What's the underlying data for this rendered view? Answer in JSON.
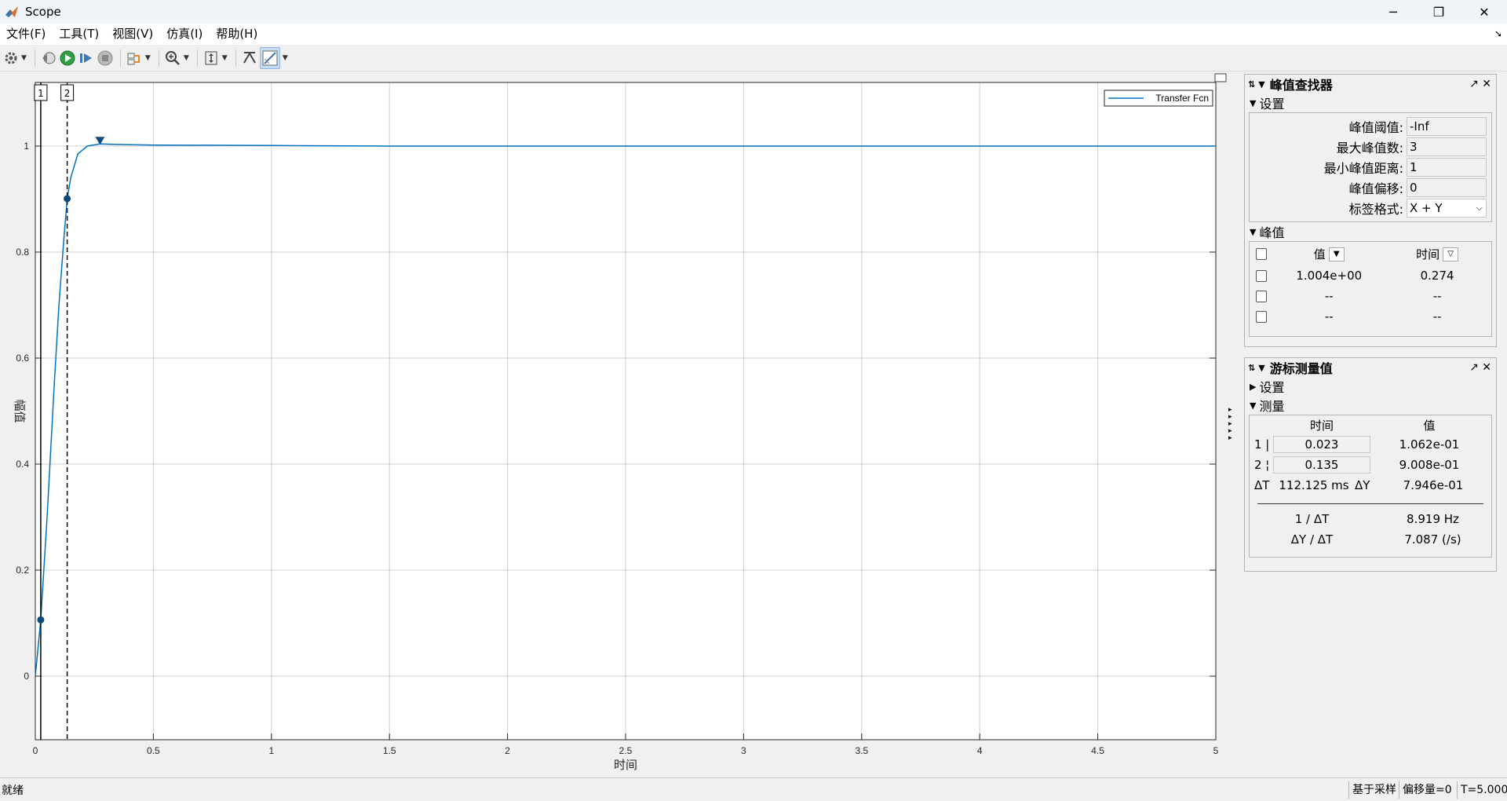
{
  "window": {
    "title": "Scope",
    "min_icon": "minimize-icon",
    "max_icon": "restore-icon",
    "close_icon": "close-icon"
  },
  "menu": {
    "items": [
      "文件(F)",
      "工具(T)",
      "视图(V)",
      "仿真(I)",
      "帮助(H)"
    ]
  },
  "toolbar": {
    "icons": [
      "settings-icon",
      "step-back-icon",
      "run-icon",
      "step-forward-icon",
      "stop-icon",
      "highlight-icon",
      "zoom-icon",
      "autoscale-icon",
      "restore-view-icon",
      "measure-icon"
    ]
  },
  "plot": {
    "legend": "Transfer Fcn",
    "ylabel": "幅值",
    "xlabel": "时间",
    "cursor_labels": [
      "1",
      "2"
    ],
    "line_color": "#0072bd"
  },
  "chart_data": {
    "type": "line",
    "series": [
      {
        "name": "Transfer Fcn",
        "x": [
          0,
          0.023,
          0.05,
          0.08,
          0.1,
          0.12,
          0.135,
          0.15,
          0.18,
          0.22,
          0.274,
          0.35,
          0.5,
          1,
          1.5,
          2,
          2.5,
          3,
          3.5,
          4,
          4.5,
          5
        ],
        "y": [
          0,
          0.1062,
          0.3,
          0.55,
          0.7,
          0.82,
          0.9008,
          0.94,
          0.985,
          1.0,
          1.004,
          1.003,
          1.002,
          1.001,
          1.0,
          1.0,
          1.0,
          1.0,
          1.0,
          1.0,
          1.0,
          1.0
        ]
      }
    ],
    "xlim": [
      0,
      5
    ],
    "ylim": [
      -0.12,
      1.12
    ],
    "xticks": [
      "0",
      "0.5",
      "1",
      "1.5",
      "2",
      "2.5",
      "3",
      "3.5",
      "4",
      "4.5",
      "5"
    ],
    "yticks": [
      "0",
      "0.2",
      "0.4",
      "0.6",
      "0.8",
      "1"
    ],
    "grid": true,
    "legend_position": "top-right",
    "cursors_x": [
      0.023,
      0.135
    ],
    "peak": {
      "x": 0.274,
      "y": 1.004
    }
  },
  "peak_finder": {
    "title": "峰值查找器",
    "settings_label": "设置",
    "fields": [
      {
        "label": "峰值阈值:",
        "value": "-Inf"
      },
      {
        "label": "最大峰值数:",
        "value": "3"
      },
      {
        "label": "最小峰值距离:",
        "value": "1"
      },
      {
        "label": "峰值偏移:",
        "value": "0"
      },
      {
        "label": "标签格式:",
        "value": "X + Y"
      }
    ],
    "peaks_label": "峰值",
    "col_value": "值",
    "col_time": "时间",
    "rows": [
      {
        "value": "1.004e+00",
        "time": "0.274"
      },
      {
        "value": "--",
        "time": "--"
      },
      {
        "value": "--",
        "time": "--"
      }
    ]
  },
  "cursor_meas": {
    "title": "游标测量值",
    "settings_label": "设置",
    "meas_label": "测量",
    "col_time": "时间",
    "col_value": "值",
    "rows": [
      {
        "idx": "1 |",
        "time": "0.023",
        "value": "1.062e-01"
      },
      {
        "idx": "2 ¦",
        "time": "0.135",
        "value": "9.008e-01"
      }
    ],
    "dt_label": "ΔT",
    "dt_value": "112.125 ms",
    "dy_label": "ΔY",
    "dy_value": "7.946e-01",
    "inv_dt_label": "1 / ΔT",
    "inv_dt_value": "8.919 Hz",
    "dydt_label": "ΔY / ΔT",
    "dydt_value": "7.087 (/s)"
  },
  "status": {
    "left": "就绪",
    "sample": "基于采样",
    "offset": "偏移量=0",
    "time": "T=5.000"
  }
}
